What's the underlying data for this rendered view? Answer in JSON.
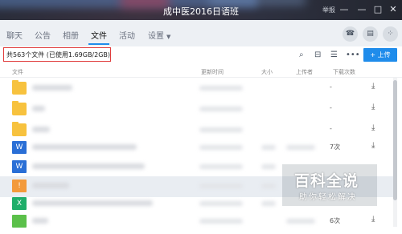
{
  "window": {
    "title": "成中医2016日语班",
    "report_label": "举报",
    "minimize_glyph": "—",
    "restore_glyph": "▢",
    "maximize_glyph": "□",
    "close_glyph": "✕"
  },
  "tabs": [
    {
      "label": "聊天"
    },
    {
      "label": "公告"
    },
    {
      "label": "相册"
    },
    {
      "label": "文件"
    },
    {
      "label": "活动"
    },
    {
      "label": "设置"
    }
  ],
  "active_tab": "文件",
  "header_actions": {
    "phone_icon": "phone-icon",
    "chat_icon": "chat-icon",
    "settings_icon": "grid-icon"
  },
  "toolbar": {
    "file_count_text": "共563个文件 (已使用1.69GB/2GB)",
    "upload_label": "+ 上传",
    "icons": [
      "search-icon",
      "folder-icon",
      "list-icon",
      "more-icon"
    ]
  },
  "table": {
    "columns": [
      "文件",
      "更新时间",
      "大小",
      "上传者",
      "下载次数"
    ],
    "rows": [
      {
        "type": "folder",
        "downloads": "-"
      },
      {
        "type": "folder",
        "downloads": "-"
      },
      {
        "type": "folder",
        "downloads": "-"
      },
      {
        "type": "word",
        "downloads": "7次"
      },
      {
        "type": "word",
        "downloads": ""
      },
      {
        "type": "orange",
        "downloads": ""
      },
      {
        "type": "excel",
        "downloads": ""
      },
      {
        "type": "green",
        "downloads": "6次"
      }
    ]
  },
  "watermark": {
    "line1": "百科全说",
    "line2": "助你轻松解决"
  },
  "colors": {
    "accent": "#1f8ceb",
    "highlight_border": "#e03c3c",
    "folder": "#f7c23e",
    "word": "#2a6fd6",
    "excel": "#1fae6a"
  }
}
